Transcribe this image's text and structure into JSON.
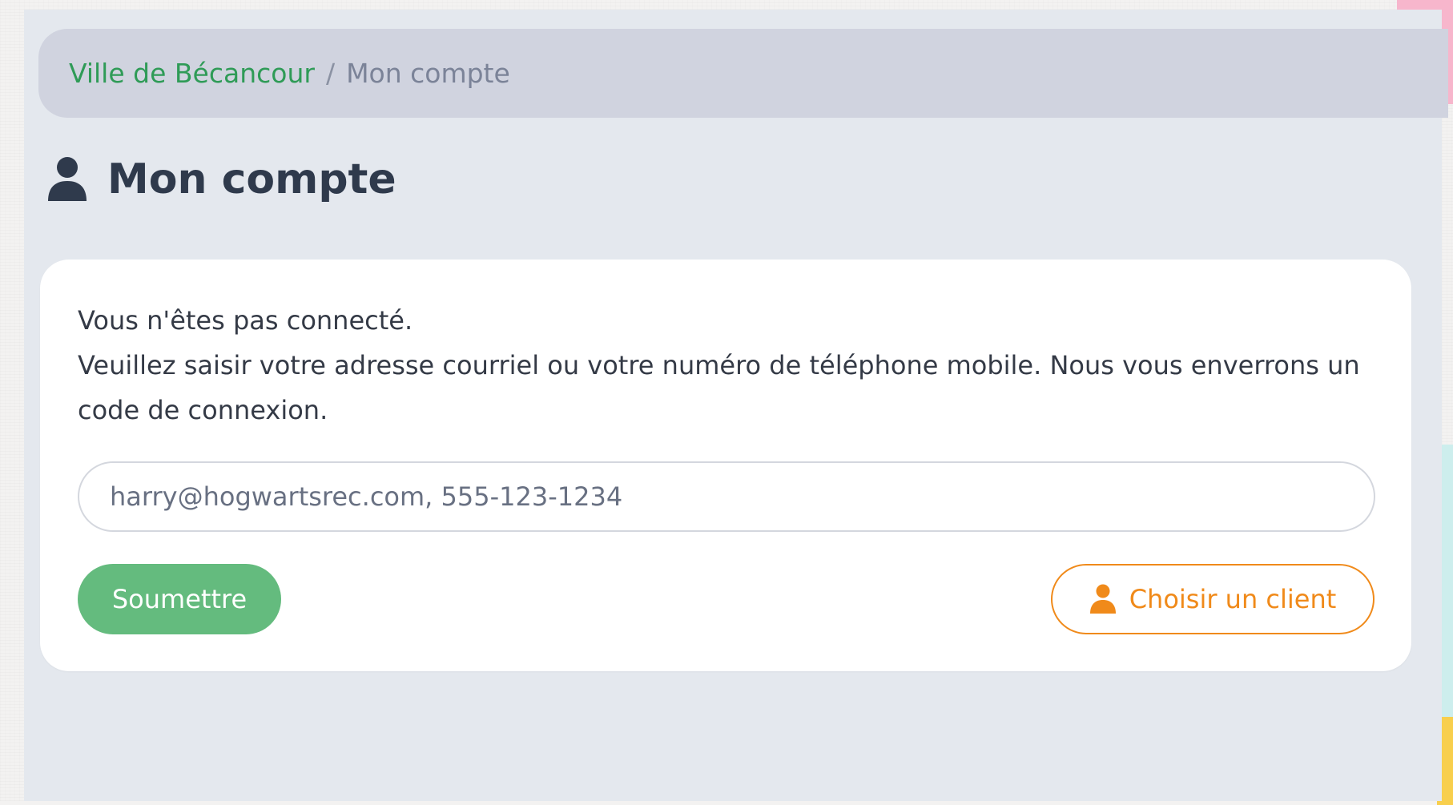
{
  "breadcrumb": {
    "home": "Ville de Bécancour",
    "separator": "/",
    "current": "Mon compte"
  },
  "page": {
    "title": "Mon compte",
    "title_icon": "user-icon"
  },
  "login": {
    "status": "Vous n'êtes pas connecté.",
    "instructions": "Veuillez saisir votre adresse courriel ou votre numéro de téléphone mobile. Nous vous enverrons un code de connexion.",
    "input_value": "",
    "input_placeholder": "harry@hogwartsrec.com, 555-123-1234",
    "submit_label": "Soumettre",
    "choose_client_label": "Choisir un client",
    "choose_client_icon": "user-icon"
  },
  "colors": {
    "accent_green": "#64bb7e",
    "link_green": "#2f9b57",
    "accent_orange": "#f08a1a",
    "text_dark": "#2f3a4c"
  }
}
